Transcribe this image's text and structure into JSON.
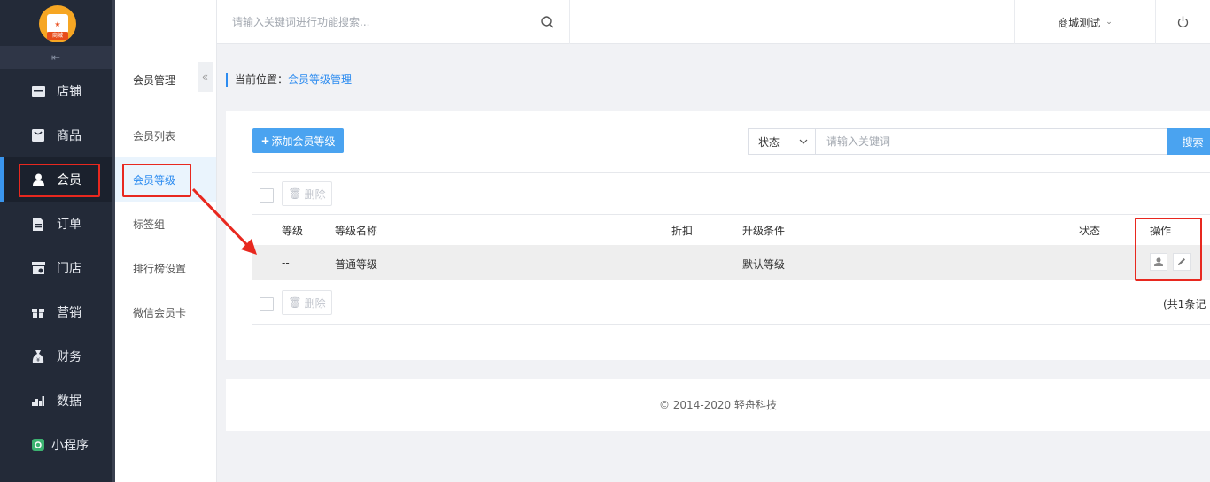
{
  "logo": {
    "text": "商城"
  },
  "sidebar": {
    "items": [
      {
        "label": "店铺",
        "icon": "store-icon"
      },
      {
        "label": "商品",
        "icon": "goods-icon"
      },
      {
        "label": "会员",
        "icon": "user-icon"
      },
      {
        "label": "订单",
        "icon": "order-icon"
      },
      {
        "label": "门店",
        "icon": "shop-icon"
      },
      {
        "label": "营销",
        "icon": "gift-icon"
      },
      {
        "label": "财务",
        "icon": "money-bag-icon"
      },
      {
        "label": "数据",
        "icon": "bar-chart-icon"
      },
      {
        "label": "小程序",
        "icon": "miniprogram-icon"
      }
    ],
    "active_index": 2,
    "accent_color": "#3a95ee"
  },
  "submenu": {
    "title": "会员管理",
    "items": [
      {
        "label": "会员列表"
      },
      {
        "label": "会员等级"
      },
      {
        "label": "标签组"
      },
      {
        "label": "排行榜设置"
      },
      {
        "label": "微信会员卡"
      }
    ],
    "active_index": 1
  },
  "header": {
    "search_placeholder": "请输入关键词进行功能搜索...",
    "shop_name": "商城测试"
  },
  "breadcrumb": {
    "prefix": "当前位置：",
    "current": "会员等级管理"
  },
  "toolbar": {
    "add_label": "添加会员等级",
    "status_label": "状态",
    "keyword_placeholder": "请输入关键词",
    "search_label": "搜索",
    "delete_label": "删除"
  },
  "table": {
    "columns": [
      "等级",
      "等级名称",
      "折扣",
      "升级条件",
      "状态",
      "操作"
    ],
    "rows": [
      {
        "level": "--",
        "name": "普通等级",
        "discount": "",
        "condition": "默认等级",
        "status": ""
      }
    ],
    "total_text": "(共1条记"
  },
  "footer": {
    "copyright": "© 2014-2020 轻舟科技"
  },
  "colors": {
    "primary": "#4aa3f0",
    "link": "#2d8cf0",
    "highlight": "#e8281f"
  }
}
